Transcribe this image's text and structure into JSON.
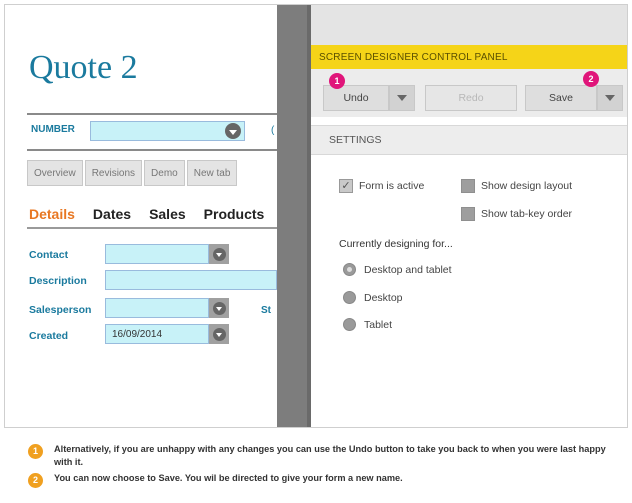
{
  "form": {
    "title": "Quote 2",
    "number_label": "NUMBER",
    "number_value": "",
    "cut_char": "(",
    "tabs": [
      "Overview",
      "Revisions",
      "Demo",
      "New tab"
    ],
    "subtabs": [
      "Details",
      "Dates",
      "Sales",
      "Products"
    ],
    "active_subtab": "Details",
    "fields": [
      {
        "label": "Contact",
        "value": ""
      },
      {
        "label": "Description",
        "value": ""
      },
      {
        "label": "Salesperson",
        "value": ""
      },
      {
        "label": "Created",
        "value": "16/09/2014"
      }
    ],
    "side_label": "St"
  },
  "panel": {
    "header": "SCREEN DESIGNER CONTROL PANEL",
    "undo_label": "Undo",
    "redo_label": "Redo",
    "save_label": "Save",
    "badge_1": "1",
    "badge_2": "2",
    "settings_label": "SETTINGS",
    "form_active_label": "Form is active",
    "form_active_checked": true,
    "show_design_layout_label": "Show design layout",
    "show_tab_key_order_label": "Show tab-key order",
    "designing_for_label": "Currently designing for...",
    "design_targets": [
      "Desktop and tablet",
      "Desktop",
      "Tablet"
    ],
    "selected_target": "Desktop and tablet"
  },
  "notes": [
    {
      "badge": "1",
      "text": "Alternatively, if you are unhappy with any changes you can use the Undo button to take you back to when you were last happy with it."
    },
    {
      "badge": "2",
      "text": "You can now choose to Save. You wil be directed to give your form a new name."
    }
  ],
  "colors": {
    "accent_blue": "#1a7a9e",
    "active_orange": "#e87722",
    "panel_yellow": "#f5d418",
    "callout_pink": "#e0157a",
    "note_orange": "#f0a020",
    "input_cyan": "#c8f2f8"
  }
}
